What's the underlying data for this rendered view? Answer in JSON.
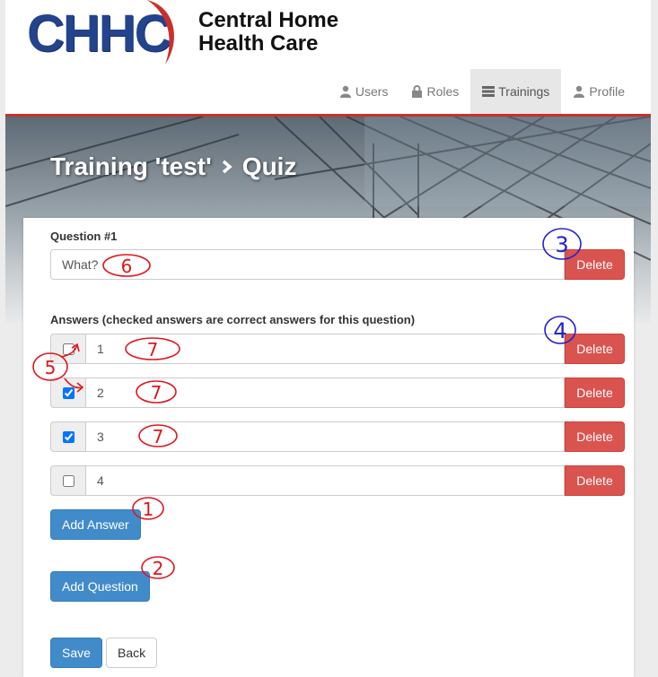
{
  "brand": {
    "logo_letters": "CHHC",
    "name_line1": "Central Home",
    "name_line2": "Health Care",
    "colors": {
      "logo_blue": "#23438d",
      "logo_red": "#c9302c"
    }
  },
  "nav": {
    "items": [
      {
        "label": "Users",
        "icon": "user-icon",
        "active": false
      },
      {
        "label": "Roles",
        "icon": "lock-icon",
        "active": false
      },
      {
        "label": "Trainings",
        "icon": "tasks-icon",
        "active": true
      },
      {
        "label": "Profile",
        "icon": "user-icon",
        "active": false
      }
    ]
  },
  "hero": {
    "training": "Training 'test'",
    "separator_icon": "chevron-right-icon",
    "section": "Quiz"
  },
  "question": {
    "label": "Question #1",
    "value": "What?",
    "delete_label": "Delete"
  },
  "answers": {
    "label": "Answers (checked answers are correct answers for this question)",
    "items": [
      {
        "value": "1",
        "checked": false,
        "delete_label": "Delete"
      },
      {
        "value": "2",
        "checked": true,
        "delete_label": "Delete"
      },
      {
        "value": "3",
        "checked": true,
        "delete_label": "Delete"
      },
      {
        "value": "4",
        "checked": false,
        "delete_label": "Delete"
      }
    ]
  },
  "buttons": {
    "add_answer": "Add Answer",
    "add_question": "Add Question",
    "save": "Save",
    "back": "Back"
  },
  "annotations": {
    "marks": [
      "1",
      "2",
      "3",
      "4",
      "5",
      "6",
      "7",
      "7",
      "7"
    ],
    "colors": {
      "red": "#e0161c",
      "blue": "#2222cc"
    }
  }
}
